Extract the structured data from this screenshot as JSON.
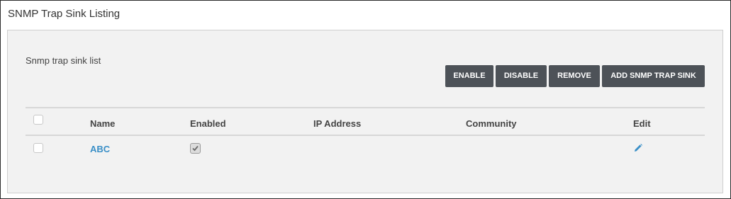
{
  "page": {
    "title": "SNMP Trap Sink Listing"
  },
  "panel": {
    "list_label": "Snmp trap sink list"
  },
  "toolbar": {
    "enable_label": "ENABLE",
    "disable_label": "DISABLE",
    "remove_label": "REMOVE",
    "add_label": "ADD SNMP TRAP SINK"
  },
  "table": {
    "columns": [
      "",
      "Name",
      "Enabled",
      "IP Address",
      "Community",
      "Edit"
    ],
    "rows": [
      {
        "selected": false,
        "name": "ABC",
        "enabled": true,
        "ip_address": "",
        "community": "",
        "edit_icon": "pencil-icon"
      }
    ]
  },
  "colors": {
    "button_bg": "#4d5258",
    "link": "#3a8fc7",
    "panel_bg": "#f2f2f2"
  }
}
